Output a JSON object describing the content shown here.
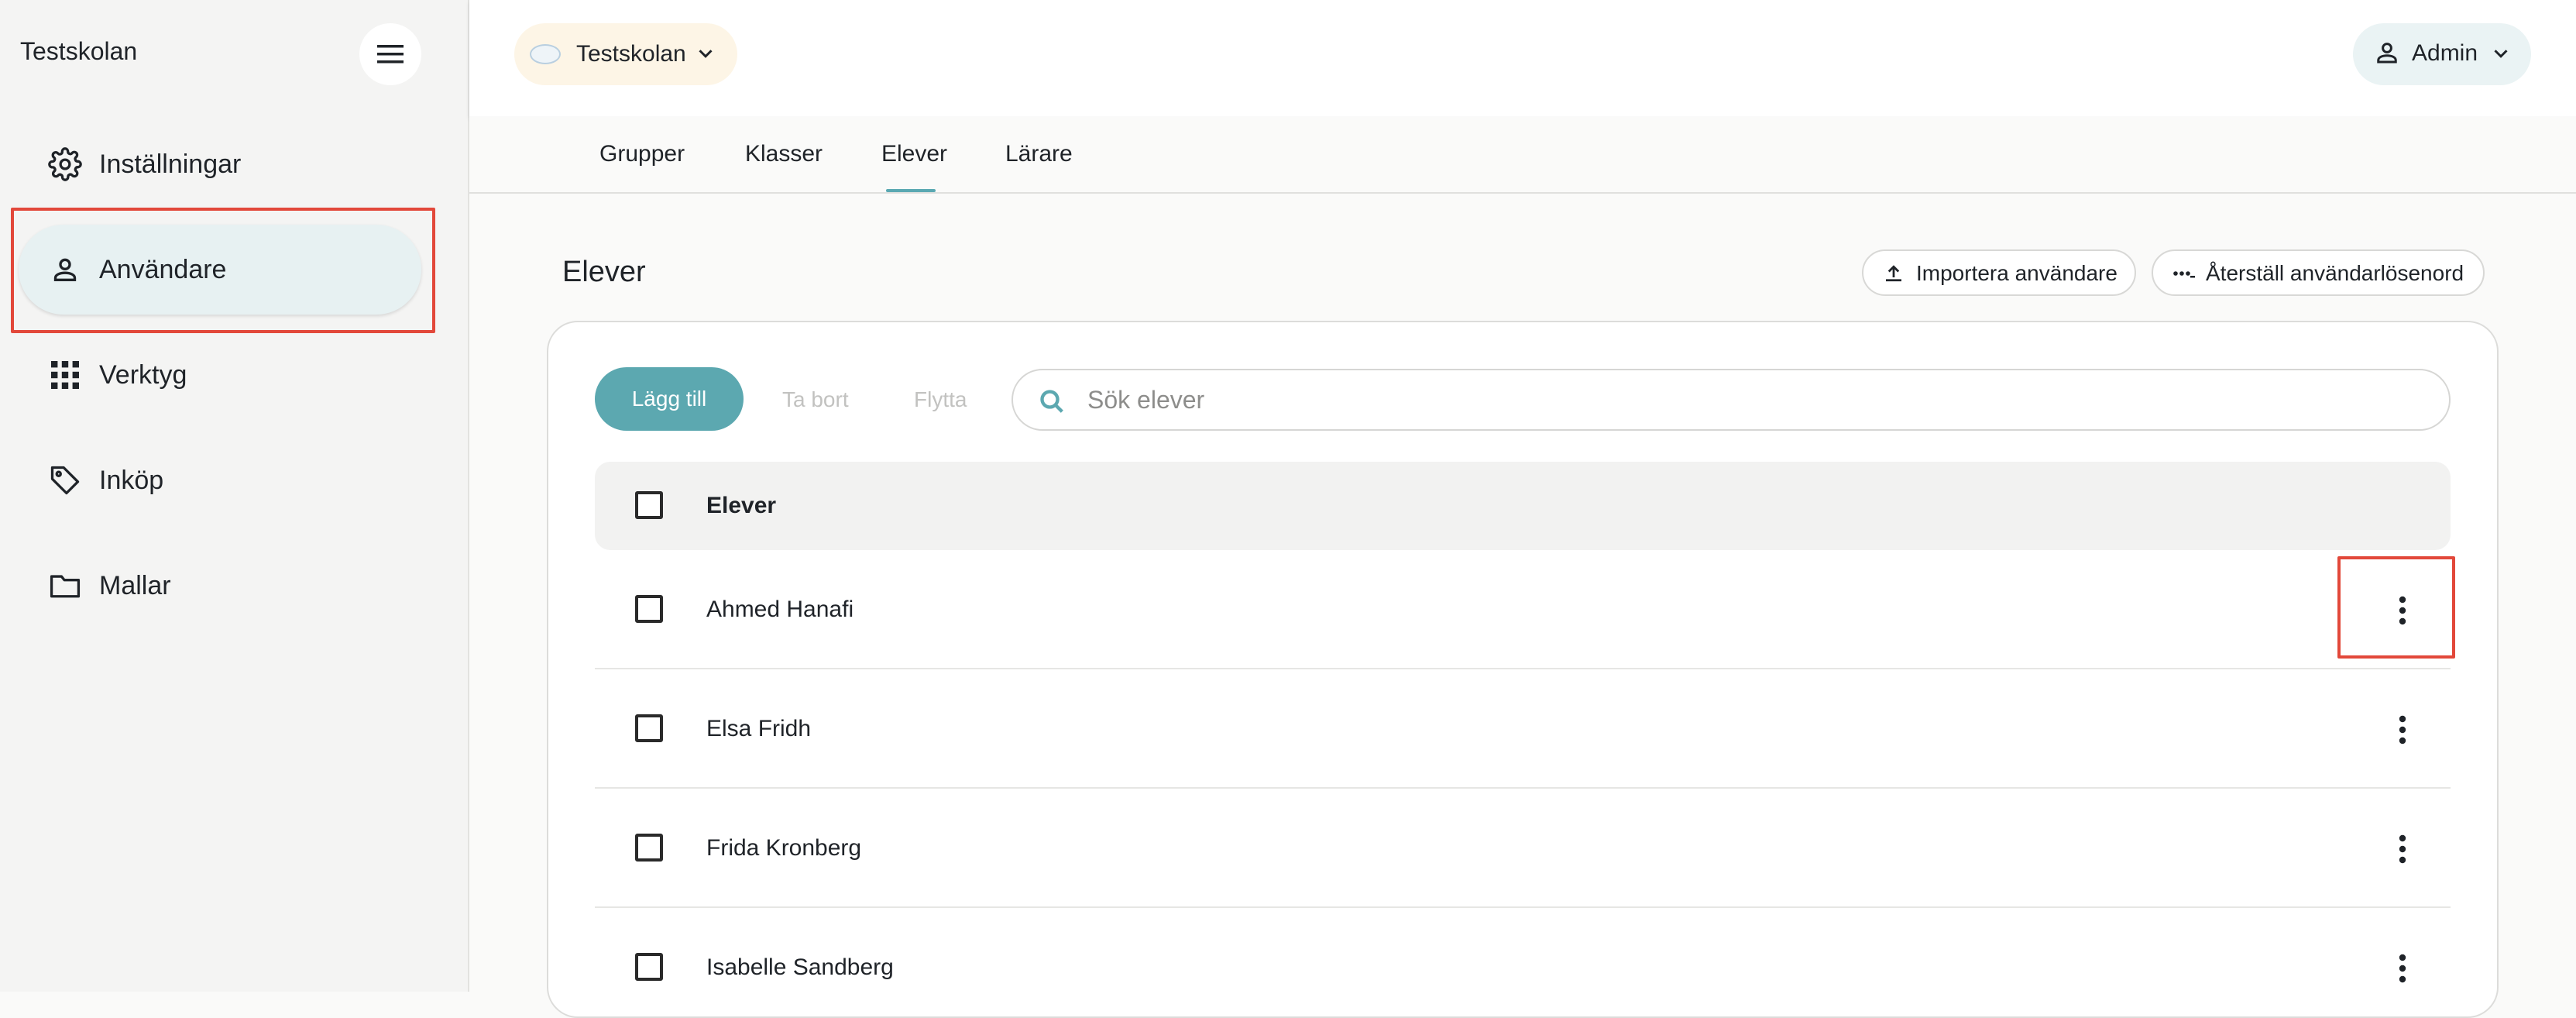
{
  "sidebar": {
    "brand": "Testskolan",
    "items": [
      {
        "label": "Inställningar",
        "icon": "gear-icon"
      },
      {
        "label": "Användare",
        "icon": "user-icon",
        "active": true
      },
      {
        "label": "Verktyg",
        "icon": "grid-icon"
      },
      {
        "label": "Inköp",
        "icon": "tag-icon"
      },
      {
        "label": "Mallar",
        "icon": "folder-icon"
      }
    ]
  },
  "header": {
    "school": "Testskolan",
    "user": "Admin"
  },
  "tabs": [
    "Grupper",
    "Klasser",
    "Elever",
    "Lärare"
  ],
  "active_tab": "Elever",
  "main": {
    "title": "Elever",
    "import_label": "Importera användare",
    "reset_label": "Återställ användarlösenord",
    "add_label": "Lägg till",
    "remove_label": "Ta bort",
    "move_label": "Flytta",
    "search_placeholder": "Sök elever",
    "column_header": "Elever",
    "students": [
      "Ahmed Hanafi",
      "Elsa Fridh",
      "Frida Kronberg",
      "Isabelle Sandberg"
    ]
  },
  "colors": {
    "accent": "#5ca8b0",
    "highlight": "#e2483a",
    "active_nav_bg": "#e7f1f2"
  }
}
